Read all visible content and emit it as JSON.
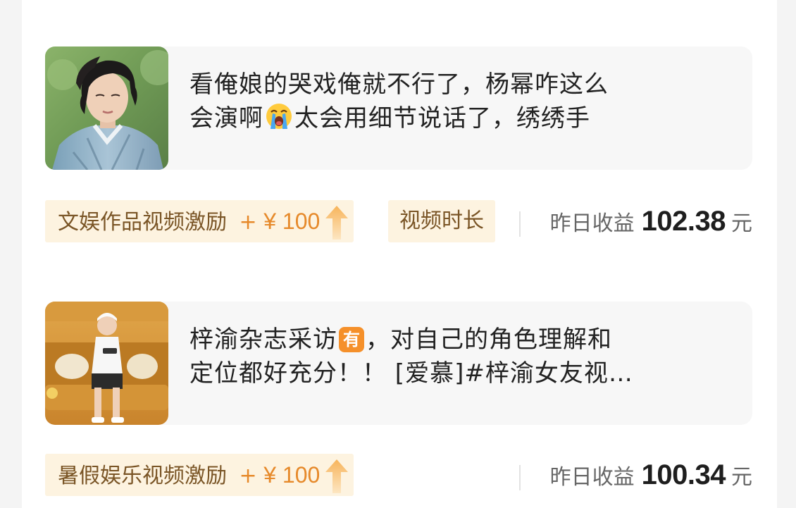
{
  "items": [
    {
      "post": {
        "line1": "看俺娘的哭戏俺就不行了，杨幂咋这么",
        "line2_before_emoji": "会演啊",
        "line2_after_emoji": "太会用细节说话了，绣绣手"
      },
      "incentive_tag": {
        "label": "文娱作品视频激励",
        "plus": "+",
        "amount": "¥ 100"
      },
      "duration_tag": "视频时长",
      "earnings": {
        "label": "昨日收益",
        "amount": "102.38",
        "unit": "元"
      }
    },
    {
      "post": {
        "line1_before_badge": "梓渝杂志采访",
        "badge": "有",
        "line1_after_badge": "，对自己的角色理解和",
        "line2": "定位都好充分！！ [爱慕]#梓渝女友视…"
      },
      "incentive_tag": {
        "label": "暑假娱乐视频激励",
        "plus": "+",
        "amount": "¥ 100"
      },
      "earnings": {
        "label": "昨日收益",
        "amount": "100.34",
        "unit": "元"
      }
    }
  ],
  "colors": {
    "tag_background": "#fdf3e0",
    "tag_text": "#7a5526",
    "accent_orange": "#e6892a",
    "badge_orange": "#f5902a",
    "preview_background": "#f7f7f7"
  },
  "icons": {
    "crying_emoji": "loudly-crying-face-icon",
    "trend_arrow": "up-arrow-icon"
  }
}
